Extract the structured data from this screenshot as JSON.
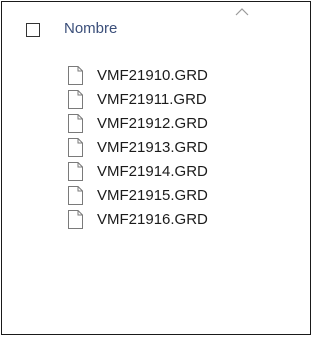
{
  "header": {
    "column_label": "Nombre",
    "sort_indicator_icon": "chevron-up-icon",
    "column_label_color": "#3b4f7a"
  },
  "files": [
    {
      "name": "VMF21910.GRD",
      "icon": "document-icon"
    },
    {
      "name": "VMF21911.GRD",
      "icon": "document-icon"
    },
    {
      "name": "VMF21912.GRD",
      "icon": "document-icon"
    },
    {
      "name": "VMF21913.GRD",
      "icon": "document-icon"
    },
    {
      "name": "VMF21914.GRD",
      "icon": "document-icon"
    },
    {
      "name": "VMF21915.GRD",
      "icon": "document-icon"
    },
    {
      "name": "VMF21916.GRD",
      "icon": "document-icon"
    }
  ]
}
